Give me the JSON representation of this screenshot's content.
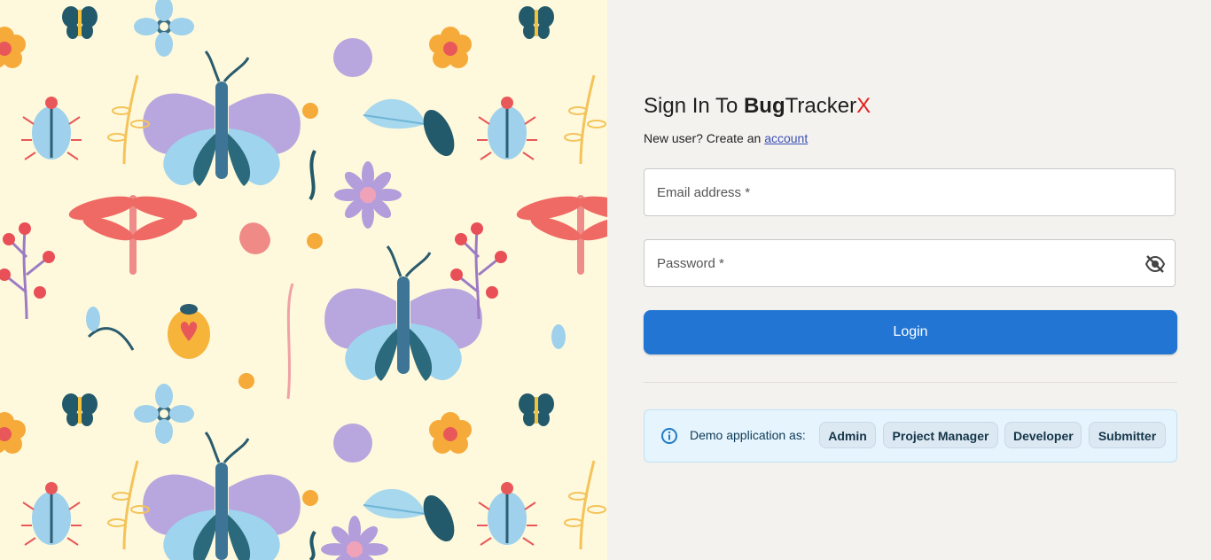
{
  "background": {
    "color": "#fef9dc",
    "motif": "insects-and-flowers-pattern"
  },
  "form": {
    "title_prefix": "Sign In To ",
    "brand_bold": "Bug",
    "brand_regular": "Tracker",
    "brand_accent": "X",
    "new_user_text": "New user? Create an ",
    "account_link": "account",
    "email_placeholder": "Email address *",
    "password_placeholder": "Password *",
    "password_toggle_icon": "eye-off-icon",
    "login_label": "Login"
  },
  "demo": {
    "label": "Demo application as:",
    "icon": "info-icon",
    "roles": [
      "Admin",
      "Project Manager",
      "Developer",
      "Submitter"
    ]
  },
  "colors": {
    "primary": "#2275d2",
    "accent_x": "#e41e1e",
    "link": "#3a4fb5",
    "demo_bg": "#e5f4fd",
    "panel_bg": "#f4f2ee"
  }
}
